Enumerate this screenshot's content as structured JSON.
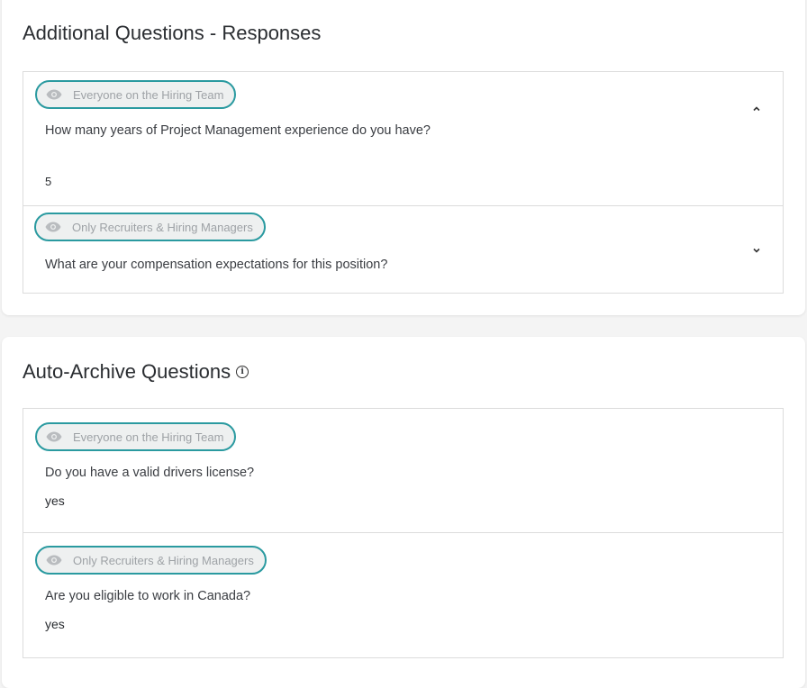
{
  "additional": {
    "title": "Additional Questions - Responses",
    "items": [
      {
        "visibility": "Everyone on the Hiring Team",
        "question": "How many years of Project Management experience do you have?",
        "answer": "5",
        "expanded": true
      },
      {
        "visibility": "Only Recruiters & Hiring Managers",
        "question": "What are your compensation expectations for this position?",
        "expanded": false
      }
    ]
  },
  "auto_archive": {
    "title": "Auto-Archive Questions",
    "info_icon": "i",
    "items": [
      {
        "visibility": "Everyone on the Hiring Team",
        "question": "Do you have a valid drivers license?",
        "answer": "yes"
      },
      {
        "visibility": "Only Recruiters & Hiring Managers",
        "question": "Are you eligible to work in Canada?",
        "answer": "yes"
      }
    ]
  },
  "colors": {
    "pill_border": "#2a9aa0",
    "pill_bg": "#eef0f0",
    "pill_text": "#9ea2a6",
    "page_bg": "#f4f4f4"
  }
}
